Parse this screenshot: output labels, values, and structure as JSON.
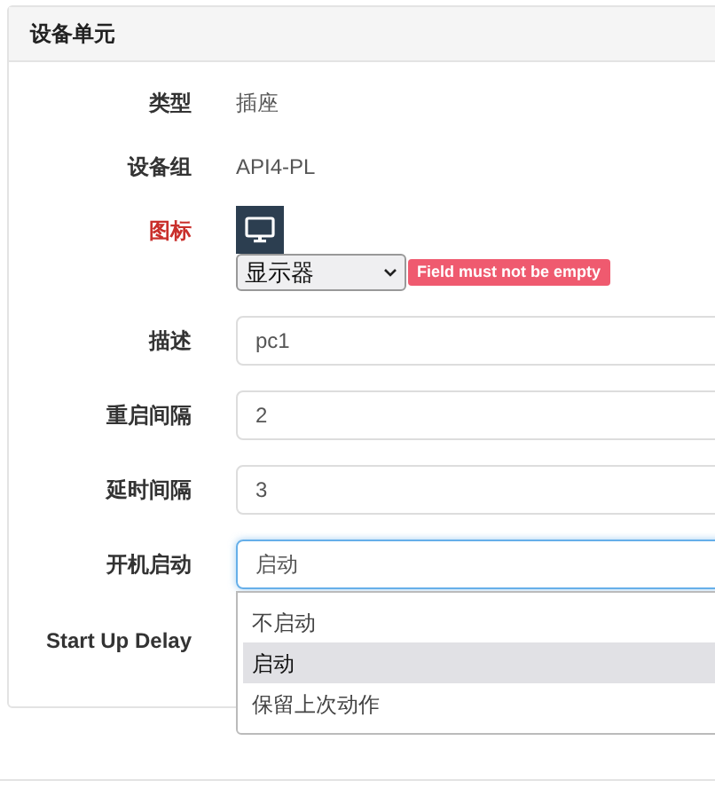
{
  "panel": {
    "title": "设备单元"
  },
  "rows": [
    {
      "kind": "text",
      "label": "类型",
      "value": "插座"
    },
    {
      "kind": "text",
      "label": "设备组",
      "value": "API4-PL"
    },
    {
      "kind": "icon_select",
      "label": "图标",
      "invalid": true,
      "value": "显示器",
      "error": "Field must not be empty"
    },
    {
      "kind": "input",
      "label": "描述",
      "value": "pc1"
    },
    {
      "kind": "input",
      "label": "重启间隔",
      "value": "2"
    },
    {
      "kind": "input",
      "label": "延时间隔",
      "value": "3"
    },
    {
      "kind": "select",
      "label": "开机启动",
      "value": "启动",
      "expanded": true,
      "options": [
        {
          "label": "不启动",
          "selected": false
        },
        {
          "label": "启动",
          "selected": true
        },
        {
          "label": "保留上次动作",
          "selected": false
        }
      ]
    },
    {
      "kind": "label",
      "label": "Start Up Delay"
    }
  ]
}
